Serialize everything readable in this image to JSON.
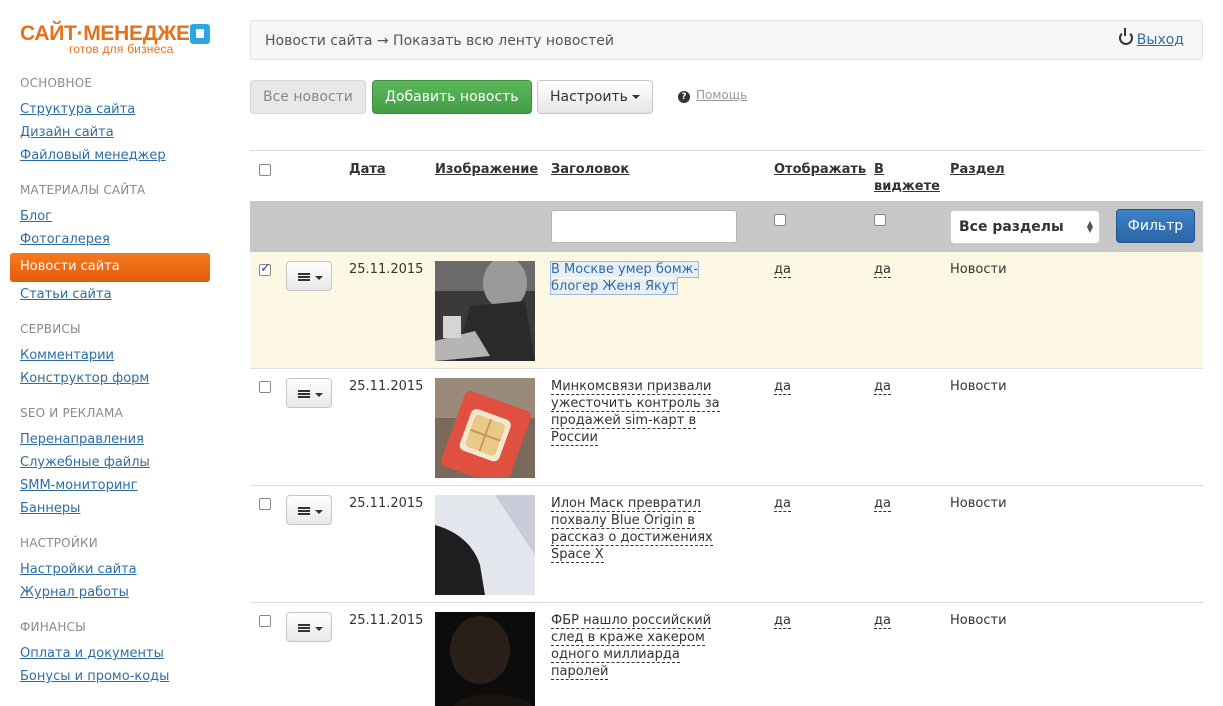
{
  "brand": {
    "title": "САЙТ·МЕНЕДЖЕР",
    "subtitle": "готов для бизнеса",
    "accent_color": "#e8701a",
    "badge_color": "#2aa7e0"
  },
  "sidebar": {
    "sections": [
      {
        "title": "ОСНОВНОЕ",
        "items": [
          "Структура сайта",
          "Дизайн сайта",
          "Файловый менеджер"
        ]
      },
      {
        "title": "МАТЕРИАЛЫ САЙТА",
        "items": [
          "Блог",
          "Фотогалерея",
          "Новости сайта",
          "Статьи сайта"
        ]
      },
      {
        "title": "СЕРВИСЫ",
        "items": [
          "Комментарии",
          "Конструктор форм"
        ]
      },
      {
        "title": "SEO И РЕКЛАМА",
        "items": [
          "Перенаправления",
          "Служебные файлы",
          "SMM-мониторинг",
          "Баннеры"
        ]
      },
      {
        "title": "НАСТРОЙКИ",
        "items": [
          "Настройки сайта",
          "Журнал работы"
        ]
      },
      {
        "title": "ФИНАНСЫ",
        "items": [
          "Оплата и документы",
          "Бонусы и промо-коды"
        ]
      }
    ],
    "active_item": "Новости сайта"
  },
  "topbar": {
    "breadcrumb": "Новости сайта → Показать всю ленту новостей",
    "logout_label": "Выход",
    "logout_icon": "power-icon"
  },
  "toolbar": {
    "all_news": "Все новости",
    "add_news": "Добавить новость",
    "configure": "Настроить",
    "help_icon": "question-icon",
    "help": "Помощь"
  },
  "table": {
    "columns": {
      "date": "Дата",
      "image": "Изображение",
      "title": "Заголовок",
      "display": "Отображать",
      "widget_line1": "В",
      "widget_line2": "виджете",
      "section": "Раздел"
    },
    "filter": {
      "title_value": "",
      "section_select": "Все разделы",
      "filter_button": "Фильтр"
    },
    "rows": [
      {
        "checked": true,
        "date": "25.11.2015",
        "image": "photo-man-with-phone",
        "title": "В Москве умер бомж-блогер Женя Якут",
        "display": "да",
        "widget": "да",
        "section": "Новости"
      },
      {
        "checked": false,
        "date": "25.11.2015",
        "image": "photo-sim-card",
        "title": "Минкомсвязи призвали ужесточить контроль за продажей sim-карт в России",
        "display": "да",
        "widget": "да",
        "section": "Новости"
      },
      {
        "checked": false,
        "date": "25.11.2015",
        "image": "photo-silhouette",
        "title": "Илон Маск превратил похвалу Blue Origin в рассказ о достижениях Space X",
        "display": "да",
        "widget": "да",
        "section": "Новости"
      },
      {
        "checked": false,
        "date": "25.11.2015",
        "image": "photo-dark-figure",
        "title": "ФБР нашло российский след в краже хакером одного миллиарда паролей",
        "display": "да",
        "widget": "да",
        "section": "Новости"
      }
    ]
  },
  "colors": {
    "link": "#2e6da4",
    "active_nav": "#f06e17",
    "add_button": "#4cae4c",
    "filter_button": "#3471b3",
    "selected_row": "#fcf8e3",
    "filter_bar": "#c8c8c8"
  }
}
